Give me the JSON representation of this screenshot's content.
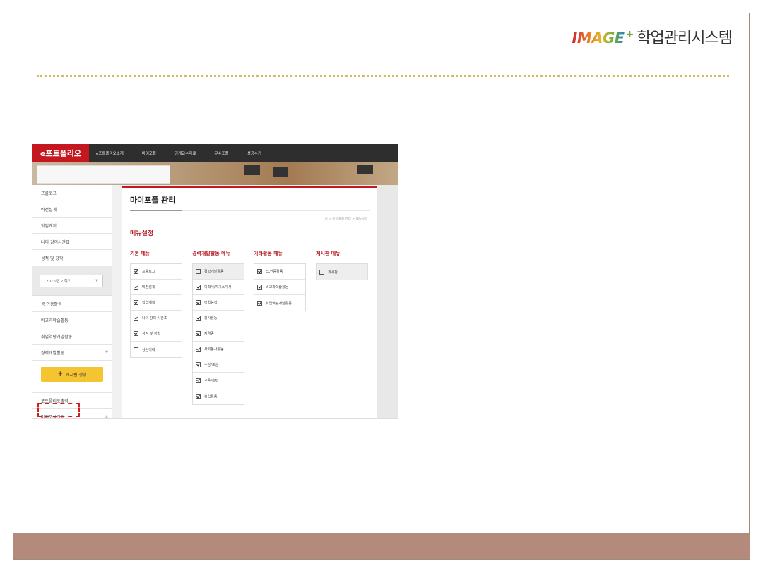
{
  "brand": {
    "image_word": "IMAGE",
    "plus": "+",
    "system_name": "학업관리시스템"
  },
  "portal": {
    "logo": "e포트폴리오",
    "top_nav": [
      "e포트폴리오소개",
      "마이포폴",
      "공개교수자료",
      "우수포폴",
      "성공수기"
    ]
  },
  "sidebar": {
    "items_top": [
      "프롤로그",
      "비전설계",
      "학업계획",
      "나의 강의시간표",
      "성적 및 장학"
    ],
    "semester": "2016년 2 학기",
    "items_mid": [
      "봉 인증활동",
      "비교과학습활동",
      "취업역량개발활동",
      "경력개발활동"
    ],
    "create_button": "게시판 생성",
    "items_bottom": [
      "포트폴리오출력",
      "마이포폴관리"
    ]
  },
  "content": {
    "page_title": "마이포폴 관리",
    "breadcrumb": "홈 > 마이포폴 관리 > 메뉴설정",
    "section_title": "메뉴설정",
    "columns": [
      {
        "title": "기본 메뉴",
        "options": [
          {
            "label": "프롤로그",
            "checked": true
          },
          {
            "label": "비전설계",
            "checked": true
          },
          {
            "label": "학업계획",
            "checked": true
          },
          {
            "label": "나의 강의 시간표",
            "checked": true
          },
          {
            "label": "성적 및 장학",
            "checked": true
          },
          {
            "label": "상담이력",
            "checked": false
          }
        ]
      },
      {
        "title": "경력개발활동 메뉴",
        "options": [
          {
            "label": "경력개발활동",
            "checked": false
          },
          {
            "label": "이력서/자기소개서",
            "checked": true
          },
          {
            "label": "어학능력",
            "checked": true
          },
          {
            "label": "봉사활동",
            "checked": true
          },
          {
            "label": "자격증",
            "checked": true
          },
          {
            "label": "사회봉사활동",
            "checked": true
          },
          {
            "label": "수상/포상",
            "checked": true
          },
          {
            "label": "교육/훈련",
            "checked": true
          },
          {
            "label": "취업활동",
            "checked": true
          }
        ]
      },
      {
        "title": "기타활동 메뉴",
        "options": [
          {
            "label": "EL인증활동",
            "checked": true
          },
          {
            "label": "비교과학습활동",
            "checked": true
          },
          {
            "label": "취업역량개발활동",
            "checked": true
          }
        ]
      },
      {
        "title": "게시판 메뉴",
        "options": [
          {
            "label": "게시판",
            "checked": false
          }
        ]
      }
    ]
  },
  "colors": {
    "accent_red": "#c4171f",
    "button_yellow": "#f4c531",
    "footer_band": "#b48a7c",
    "highlight": "#d21d1d"
  }
}
